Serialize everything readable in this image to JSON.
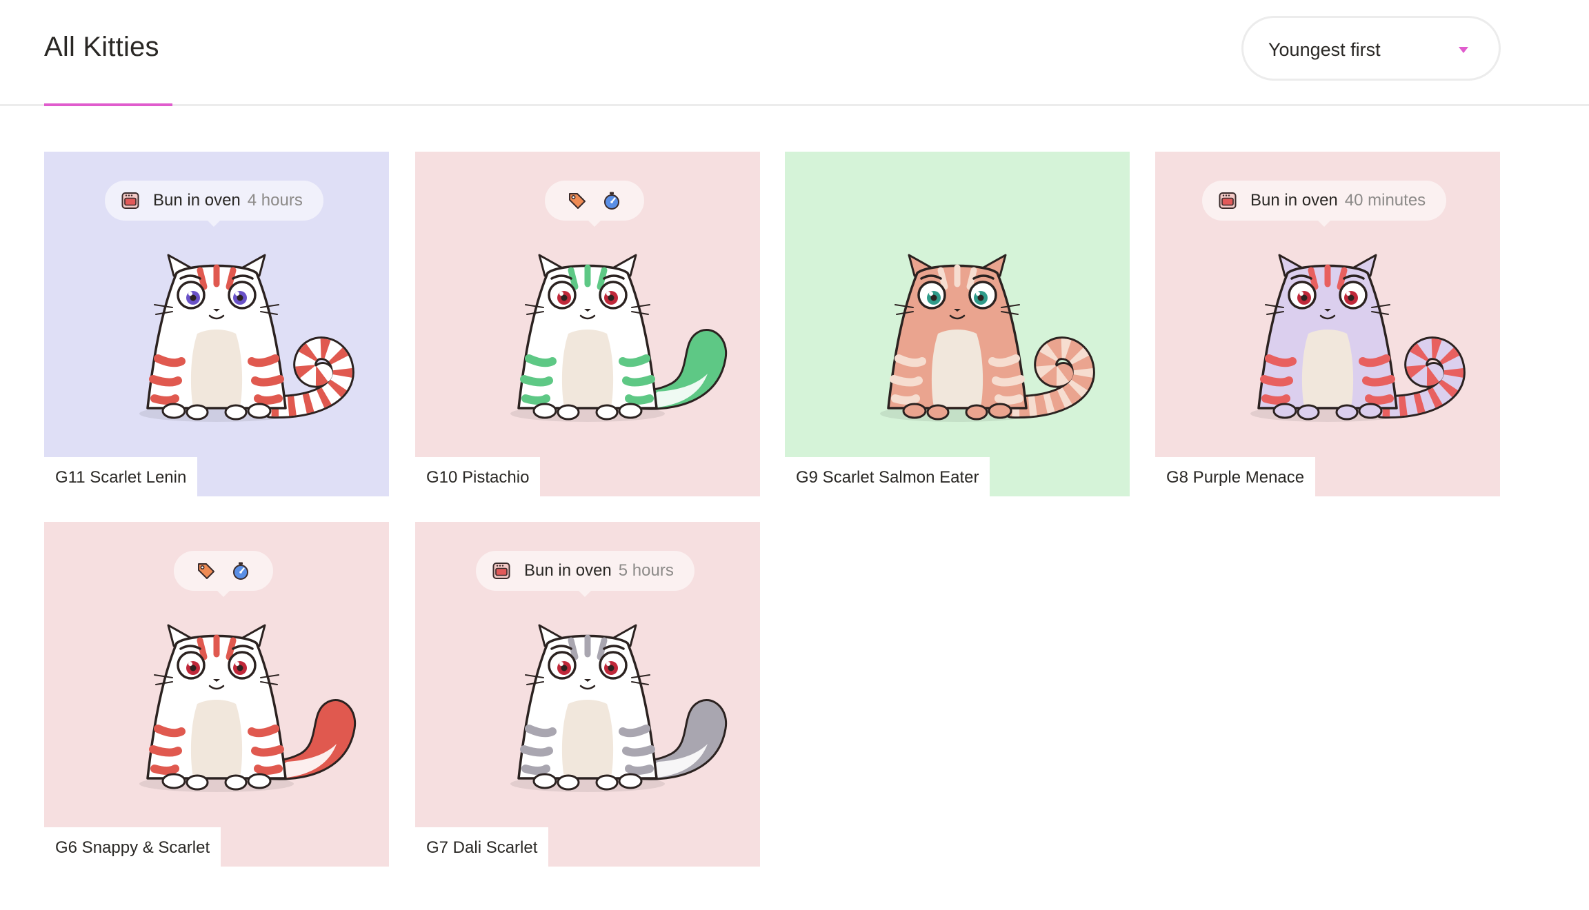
{
  "header": {
    "title": "All Kitties",
    "sort": {
      "selected": "Youngest first"
    }
  },
  "kitties": [
    {
      "name": "G11 Scarlet Lenin",
      "bg": "#dfdff6",
      "status": {
        "label": "Bun in oven",
        "time": "4 hours"
      },
      "body": "#ffffff",
      "pattern": "#e0594f",
      "eye": "#6a52c8",
      "tail": "curl"
    },
    {
      "name": "G10 Pistachio",
      "bg": "#f6dfe0",
      "status": null,
      "icons": [
        "price-tag-icon",
        "stopwatch-icon"
      ],
      "body": "#ffffff",
      "pattern": "#5ec885",
      "eye": "#c0283a",
      "tail": "fluffy"
    },
    {
      "name": "G9 Scarlet Salmon Eater",
      "bg": "#d5f3d8",
      "status": null,
      "body": "#eaa48f",
      "pattern": "#f6ddd0",
      "eye": "#2f9b8a",
      "tail": "curl"
    },
    {
      "name": "G8 Purple Menace",
      "bg": "#f6dfe0",
      "status": {
        "label": "Bun in oven",
        "time": "40 minutes"
      },
      "body": "#dbcfee",
      "pattern": "#e8605f",
      "eye": "#c0283a",
      "tail": "curl"
    },
    {
      "name": "G6 Snappy & Scarlet",
      "bg": "#f6dfe0",
      "status": null,
      "icons": [
        "price-tag-icon",
        "stopwatch-icon"
      ],
      "body": "#ffffff",
      "pattern": "#e0594f",
      "eye": "#c0283a",
      "tail": "fluffy"
    },
    {
      "name": "G7 Dali Scarlet",
      "bg": "#f6dfe0",
      "status": {
        "label": "Bun in oven",
        "time": "5 hours"
      },
      "body": "#ffffff",
      "pattern": "#a9a6b0",
      "eye": "#c0283a",
      "tail": "fluffy"
    }
  ]
}
